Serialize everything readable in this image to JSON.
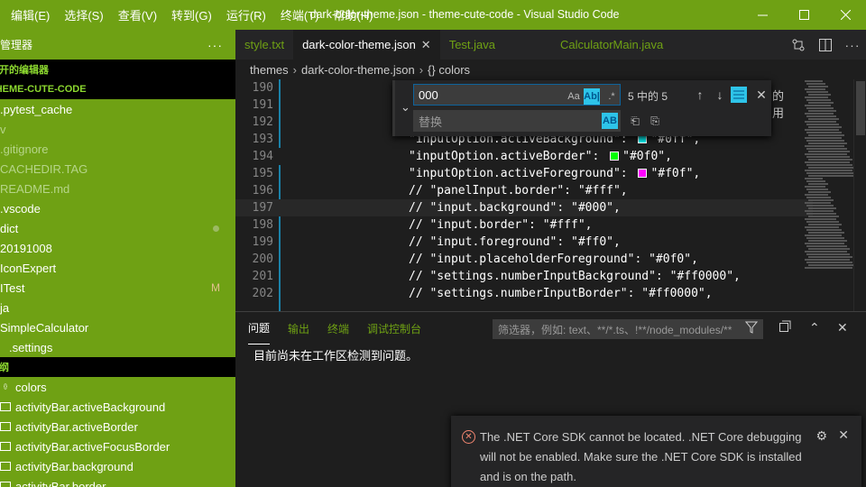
{
  "window": {
    "title": "dark-color-theme.json - theme-cute-code - Visual Studio Code",
    "menu": [
      "编辑(E)",
      "选择(S)",
      "查看(V)",
      "转到(G)",
      "运行(R)",
      "终端(T)",
      "帮助(H)"
    ]
  },
  "sidebar": {
    "title": "源管理器",
    "more": "···",
    "open_editors": "打开的编辑器",
    "project": "THEME-CUTE-CODE",
    "items": [
      {
        "label": ".pytest_cache",
        "style": "normal"
      },
      {
        "label": "v",
        "style": "dim"
      },
      {
        "label": ".gitignore",
        "style": "dim"
      },
      {
        "label": "CACHEDIR.TAG",
        "style": "dim"
      },
      {
        "label": "README.md",
        "style": "dim"
      },
      {
        "label": ".vscode",
        "style": "normal"
      },
      {
        "label": "dict",
        "style": "modified"
      },
      {
        "label": "20191008",
        "style": "normal"
      },
      {
        "label": "IconExpert",
        "style": "normal"
      },
      {
        "label": "ITest",
        "style": "modified",
        "badge": "M"
      },
      {
        "label": "ja",
        "style": "normal"
      },
      {
        "label": "SimpleCalculator",
        "style": "normal"
      },
      {
        "label": ".settings",
        "style": "normal"
      }
    ],
    "outline_header": "大纲",
    "outline": [
      {
        "label": "colors"
      },
      {
        "label": "activityBar.activeBackground"
      },
      {
        "label": "activityBar.activeBorder"
      },
      {
        "label": "activityBar.activeFocusBorder"
      },
      {
        "label": "activityBar.background"
      },
      {
        "label": "activityBar.border"
      }
    ]
  },
  "tabs": [
    {
      "label": "style.txt",
      "active": false
    },
    {
      "label": "dark-color-theme.json",
      "active": true
    },
    {
      "label": "Test.java",
      "active": false
    },
    {
      "label": "CalculatorMain.java",
      "active": false
    }
  ],
  "breadcrumbs": [
    "themes",
    "dark-color-theme.json",
    "{} colors"
  ],
  "code": {
    "lines": [
      {
        "n": "190",
        "text": ""
      },
      {
        "n": "191",
        "text": ""
      },
      {
        "n": "192",
        "text": ""
      },
      {
        "n": "193",
        "text": "\"inputOption.activeBackground\": ",
        "value": "\"#0ff\",",
        "swatch": "#00ffff"
      },
      {
        "n": "194",
        "text": "\"inputOption.activeBorder\": ",
        "value": "\"#0f0\",",
        "swatch": "#00ff00"
      },
      {
        "n": "195",
        "text": "\"inputOption.activeForeground\": ",
        "value": "\"#f0f\",",
        "swatch": "#ff00ff"
      },
      {
        "n": "196",
        "text": "// \"panelInput.border\": \"#fff\","
      },
      {
        "n": "197",
        "text": "// \"input.background\": \"#000\","
      },
      {
        "n": "198",
        "text": "// \"input.border\": \"#fff\","
      },
      {
        "n": "199",
        "text": "// \"input.foreground\": \"#ff0\","
      },
      {
        "n": "200",
        "text": "// \"input.placeholderForeground\": \"#0f0\","
      },
      {
        "n": "201",
        "text": "// \"settings.numberInputBackground\": \"#ff0000\","
      },
      {
        "n": "202",
        "text": "// \"settings.numberInputBorder\": \"#ff0000\","
      }
    ],
    "peek_right_1": "的",
    "peek_right_2": "用"
  },
  "find": {
    "query": "000",
    "replace_placeholder": "替换",
    "match_count": "5 中的 5",
    "match_case": "Aa",
    "whole_word": "Ab|",
    "regex": ".*",
    "preserve_case": "AB"
  },
  "panel": {
    "tabs": [
      "问题",
      "输出",
      "终端",
      "调试控制台"
    ],
    "filter_placeholder": "筛选器，例如: text、**/*.ts、!**/node_modules/**",
    "empty_message": "目前尚未在工作区检测到问题。"
  },
  "notification": {
    "message": "The .NET Core SDK cannot be located. .NET Core debugging will not be enabled. Make sure the .NET Core SDK is installed and is on the path."
  },
  "colors": {
    "accent": "#6fa114",
    "section_text": "#8cd82f"
  }
}
